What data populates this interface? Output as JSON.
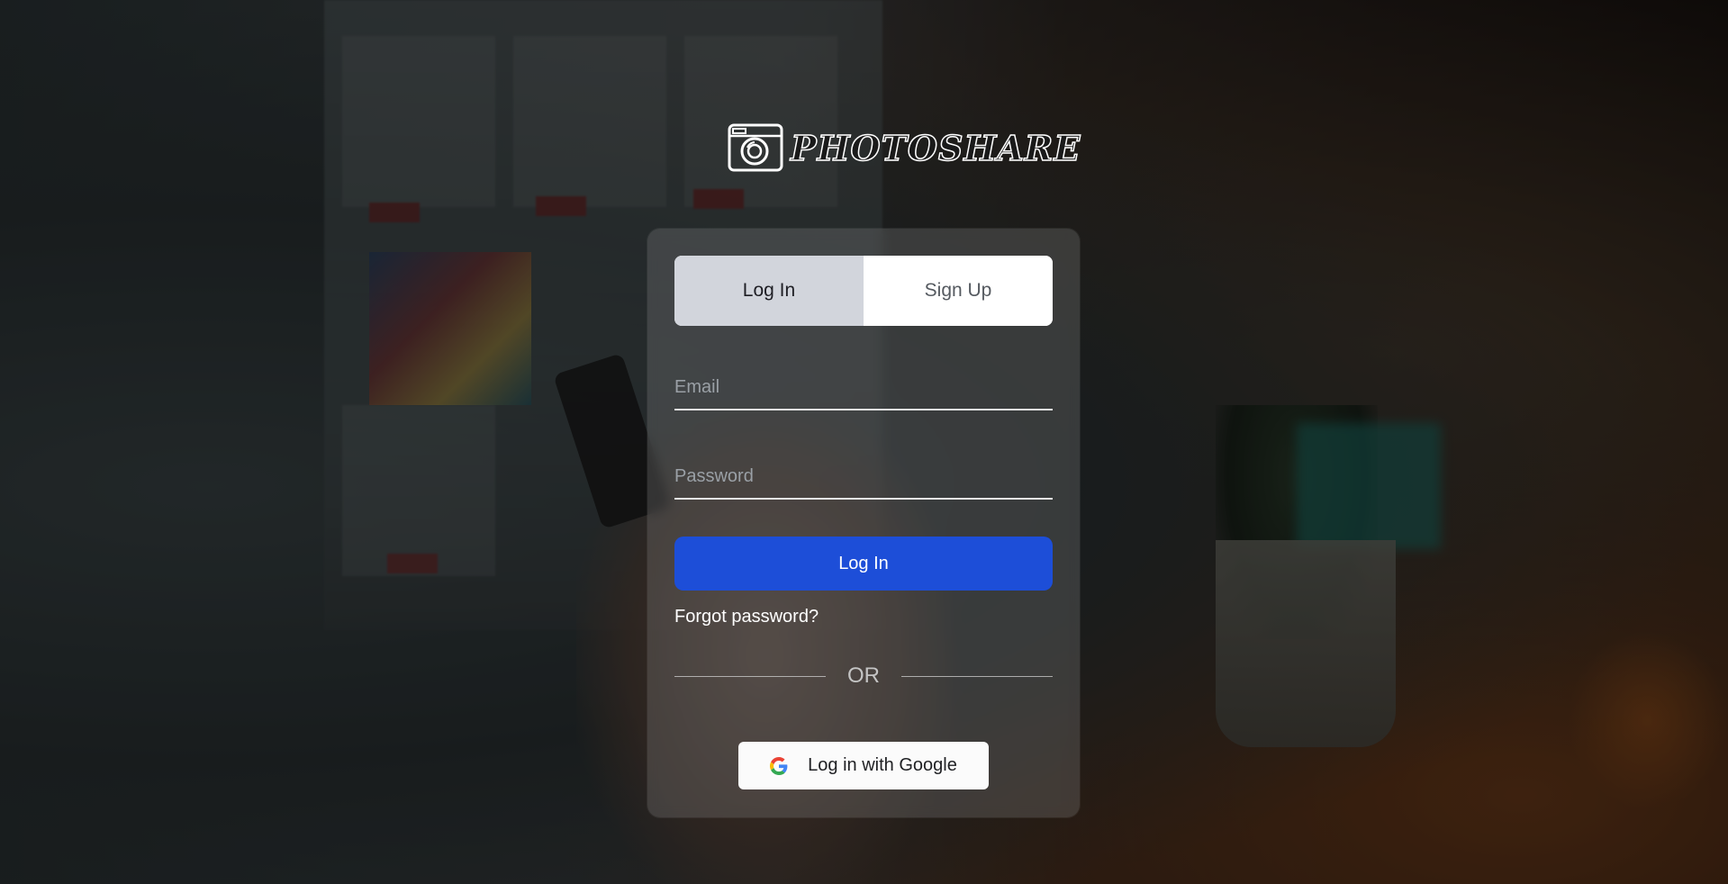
{
  "brand": {
    "name": "PHOTOSHARE",
    "logo_icon": "camera-icon"
  },
  "tabs": [
    {
      "label": "Log In",
      "active": true
    },
    {
      "label": "Sign Up",
      "active": false
    }
  ],
  "form": {
    "email_placeholder": "Email",
    "email_value": "",
    "password_placeholder": "Password",
    "password_value": "",
    "submit_label": "Log In",
    "forgot_label": "Forgot password?",
    "divider_label": "OR",
    "google_label": "Log in with Google",
    "google_icon": "google-icon"
  },
  "colors": {
    "primary": "#1d4ed8",
    "active_tab": "#d2d5dc",
    "inactive_tab": "#ffffff"
  }
}
